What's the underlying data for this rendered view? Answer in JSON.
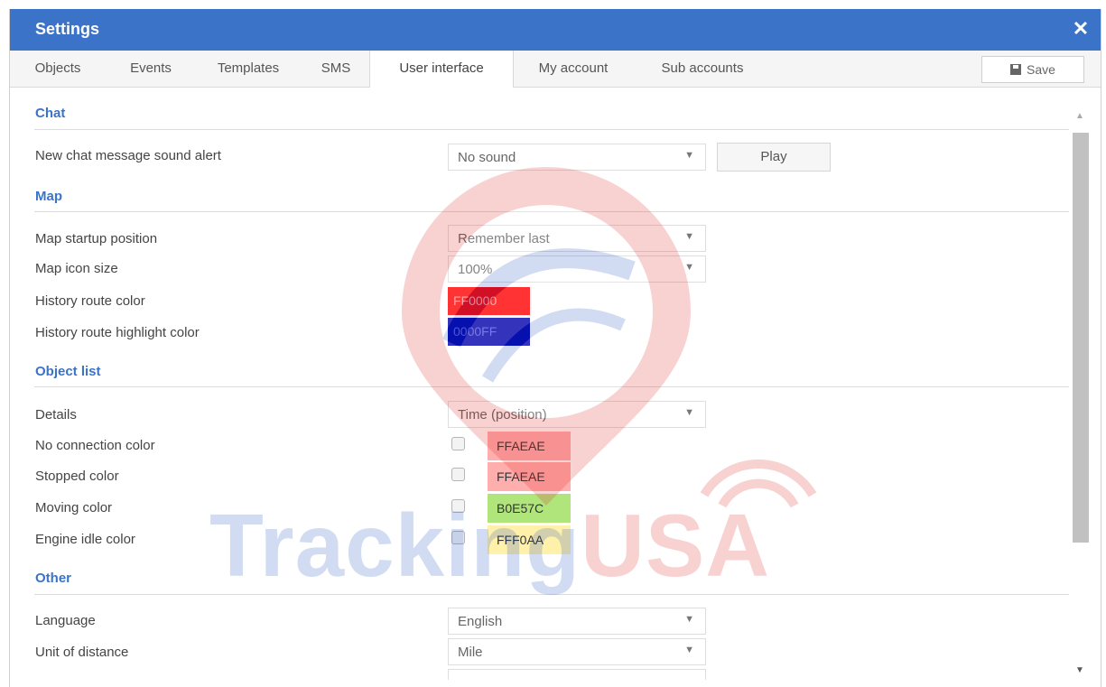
{
  "window": {
    "title": "Settings",
    "close_glyph": "✕"
  },
  "tabs": [
    {
      "label": "Objects",
      "active": false
    },
    {
      "label": "Events",
      "active": false
    },
    {
      "label": "Templates",
      "active": false
    },
    {
      "label": "SMS",
      "active": false
    },
    {
      "label": "User interface",
      "active": true
    },
    {
      "label": "My account",
      "active": false
    },
    {
      "label": "Sub accounts",
      "active": false
    }
  ],
  "toolbar": {
    "save_label": "Save",
    "save_icon": "floppy-disk-icon"
  },
  "sections": {
    "chat": {
      "title": "Chat",
      "sound_alert_label": "New chat message sound alert",
      "sound_alert_value": "No sound",
      "play_label": "Play"
    },
    "map": {
      "title": "Map",
      "startup_label": "Map startup position",
      "startup_value": "Remember last",
      "icon_size_label": "Map icon size",
      "icon_size_value": "100%",
      "route_color_label": "History route color",
      "route_color_value": "FF0000",
      "route_color_hex": "#ff0000",
      "highlight_color_label": "History route highlight color",
      "highlight_color_value": "0000FF",
      "highlight_color_hex": "#0000aa"
    },
    "object_list": {
      "title": "Object list",
      "details_label": "Details",
      "details_value": "Time (position)",
      "colors": [
        {
          "label": "No connection color",
          "value": "FFAEAE",
          "hex": "#ffaeae",
          "checked": false
        },
        {
          "label": "Stopped color",
          "value": "FFAEAE",
          "hex": "#ffaeae",
          "checked": false
        },
        {
          "label": "Moving color",
          "value": "B0E57C",
          "hex": "#b0e57c",
          "checked": false
        },
        {
          "label": "Engine idle color",
          "value": "FFF0AA",
          "hex": "#fff0aa",
          "checked": false
        }
      ]
    },
    "other": {
      "title": "Other",
      "language_label": "Language",
      "language_value": "English",
      "distance_label": "Unit of distance",
      "distance_value": "Mile"
    }
  },
  "watermark": {
    "part1": "Tracking",
    "part2": "USA"
  },
  "colors": {
    "accent": "#3a73c8",
    "titlebar": "#3a73c8"
  }
}
